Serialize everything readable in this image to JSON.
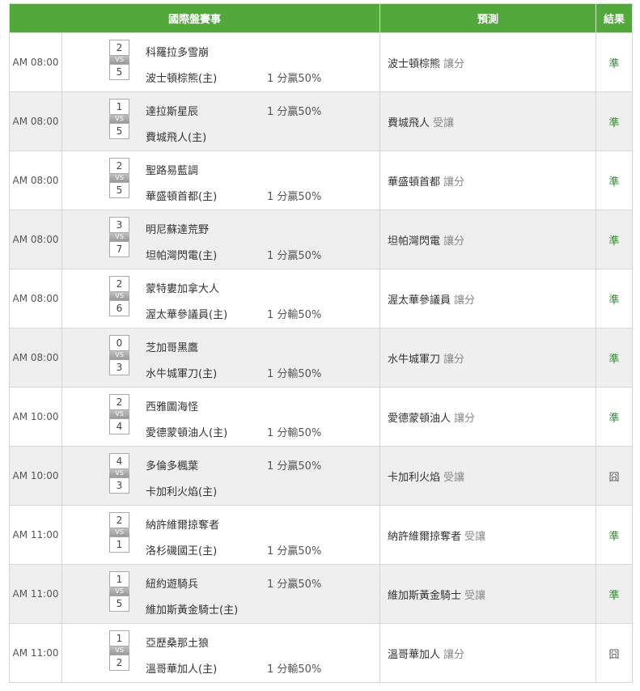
{
  "header": {
    "match": "國際盤賽事",
    "prediction": "預測",
    "result": "結果"
  },
  "vs_label": "VS",
  "rows": [
    {
      "time": "AM 08:00",
      "away_score": "2",
      "away_team": "科羅拉多雪崩",
      "away_odds": "",
      "home_score": "5",
      "home_team": "波士頓棕熊(主)",
      "home_odds": "1 分贏50%",
      "pick_team": "波士頓棕熊",
      "pick_type": "讓分",
      "result": "準"
    },
    {
      "time": "AM 08:00",
      "away_score": "1",
      "away_team": "達拉斯星辰",
      "away_odds": "1 分贏50%",
      "home_score": "5",
      "home_team": "費城飛人(主)",
      "home_odds": "",
      "pick_team": "費城飛人",
      "pick_type": "受讓",
      "result": "準"
    },
    {
      "time": "AM 08:00",
      "away_score": "2",
      "away_team": "聖路易藍調",
      "away_odds": "",
      "home_score": "5",
      "home_team": "華盛頓首都(主)",
      "home_odds": "1 分贏50%",
      "pick_team": "華盛頓首都",
      "pick_type": "讓分",
      "result": "準"
    },
    {
      "time": "AM 08:00",
      "away_score": "3",
      "away_team": "明尼蘇達荒野",
      "away_odds": "",
      "home_score": "7",
      "home_team": "坦帕灣閃電(主)",
      "home_odds": "1 分贏50%",
      "pick_team": "坦帕灣閃電",
      "pick_type": "讓分",
      "result": "準"
    },
    {
      "time": "AM 08:00",
      "away_score": "2",
      "away_team": "蒙特婁加拿大人",
      "away_odds": "",
      "home_score": "6",
      "home_team": "渥太華參議員(主)",
      "home_odds": "1 分輸50%",
      "pick_team": "渥太華參議員",
      "pick_type": "讓分",
      "result": "準"
    },
    {
      "time": "AM 08:00",
      "away_score": "0",
      "away_team": "芝加哥黑鷹",
      "away_odds": "",
      "home_score": "3",
      "home_team": "水牛城軍刀(主)",
      "home_odds": "1 分輸50%",
      "pick_team": "水牛城軍刀",
      "pick_type": "讓分",
      "result": "準"
    },
    {
      "time": "AM 10:00",
      "away_score": "2",
      "away_team": "西雅圖海怪",
      "away_odds": "",
      "home_score": "4",
      "home_team": "愛德蒙頓油人(主)",
      "home_odds": "1 分輸50%",
      "pick_team": "愛德蒙頓油人",
      "pick_type": "讓分",
      "result": "準"
    },
    {
      "time": "AM 10:00",
      "away_score": "4",
      "away_team": "多倫多楓葉",
      "away_odds": "1 分贏50%",
      "home_score": "3",
      "home_team": "卡加利火焰(主)",
      "home_odds": "",
      "pick_team": "卡加利火焰",
      "pick_type": "受讓",
      "result": "囧"
    },
    {
      "time": "AM 11:00",
      "away_score": "2",
      "away_team": "納許維爾掠奪者",
      "away_odds": "",
      "home_score": "1",
      "home_team": "洛杉磯國王(主)",
      "home_odds": "1 分贏50%",
      "pick_team": "納許維爾掠奪者",
      "pick_type": "受讓",
      "result": "準"
    },
    {
      "time": "AM 11:00",
      "away_score": "1",
      "away_team": "紐約遊騎兵",
      "away_odds": "1 分贏50%",
      "home_score": "5",
      "home_team": "維加斯黃金騎士(主)",
      "home_odds": "",
      "pick_team": "維加斯黃金騎士",
      "pick_type": "受讓",
      "result": "準"
    },
    {
      "time": "AM 11:00",
      "away_score": "1",
      "away_team": "亞歷桑那土狼",
      "away_odds": "",
      "home_score": "2",
      "home_team": "溫哥華加人(主)",
      "home_odds": "1 分輸50%",
      "pick_team": "溫哥華加人",
      "pick_type": "讓分",
      "result": "囧"
    }
  ],
  "colors": {
    "header_bg": "#52a83a",
    "win": "#2e8b2e",
    "push": "#555555",
    "row_alt": "#efefef"
  }
}
